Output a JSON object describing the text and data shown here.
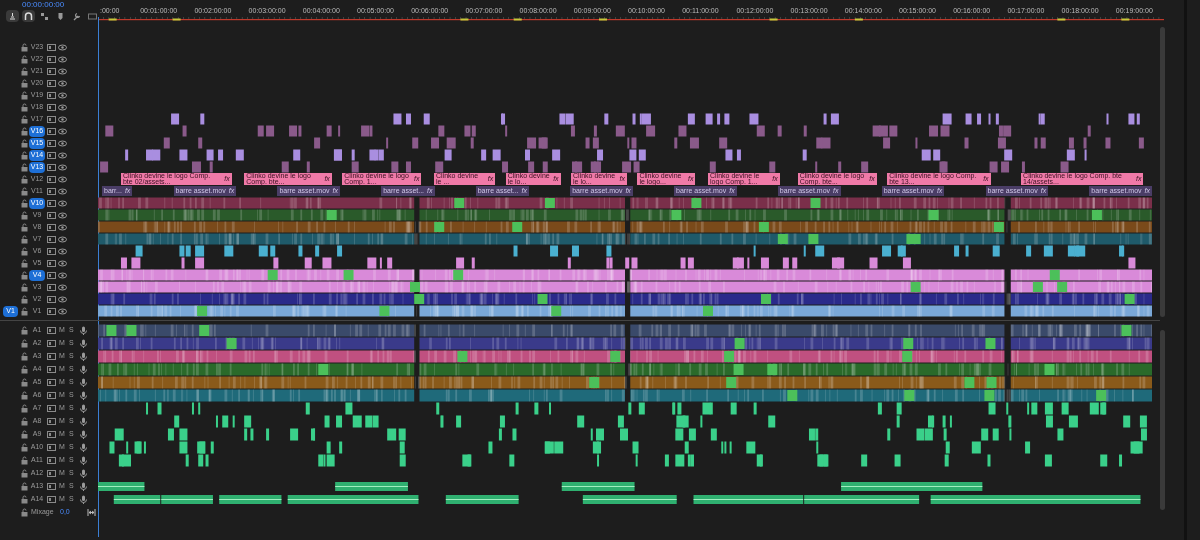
{
  "timecode": "00:00:00:00",
  "ruler": [
    ":00:00",
    "00:01:00:00",
    "00:02:00:00",
    "00:03:00:00",
    "00:04:00:00",
    "00:05:00:00",
    "00:06:00:00",
    "00:07:00:00",
    "00:08:00:00",
    "00:09:00:00",
    "00:10:00:00",
    "00:11:00:00",
    "00:12:00:00",
    "00:13:00:00",
    "00:14:00:00",
    "00:15:00:00",
    "00:16:00:00",
    "00:17:00:00",
    "00:18:00:00",
    "00:19:00:00"
  ],
  "video_tracks": [
    {
      "name": "V23",
      "targeted": false,
      "kind": "empty"
    },
    {
      "name": "V22",
      "targeted": false,
      "kind": "empty"
    },
    {
      "name": "V21",
      "targeted": false,
      "kind": "empty"
    },
    {
      "name": "V20",
      "targeted": false,
      "kind": "empty"
    },
    {
      "name": "V19",
      "targeted": false,
      "kind": "empty"
    },
    {
      "name": "V18",
      "targeted": false,
      "kind": "empty"
    },
    {
      "name": "V17",
      "targeted": false,
      "kind": "sparse",
      "color": "#a98ee0"
    },
    {
      "name": "V16",
      "targeted": true,
      "kind": "sparse",
      "color": "#8a5a8a"
    },
    {
      "name": "V15",
      "targeted": true,
      "kind": "sparse",
      "color": "#8a5a8a"
    },
    {
      "name": "V14",
      "targeted": true,
      "kind": "sparse",
      "color": "#a98ee0"
    },
    {
      "name": "V13",
      "targeted": true,
      "kind": "sparse",
      "color": "#8a5a8a"
    },
    {
      "name": "V12",
      "targeted": false,
      "kind": "titles",
      "color": "#f07aa8",
      "clips": [
        {
          "label": "Clinko devine le logo Comp. bte 02/assets...",
          "badge": "fx"
        },
        {
          "label": "Clinko devine le logo Comp. bte...",
          "badge": "fx"
        },
        {
          "label": "Clinko devine le logo Comp. 1...",
          "badge": "fx"
        },
        {
          "label": "Clinko devine le ...",
          "badge": "fx"
        },
        {
          "label": "Clinko devine le lo...",
          "badge": "fx"
        },
        {
          "label": "Clinko devine le lo...",
          "badge": "fx"
        },
        {
          "label": "Clinko devine le logo...",
          "badge": "fx"
        },
        {
          "label": "Clinko devine le logo Comp. 1...",
          "badge": "fx"
        },
        {
          "label": "Clinko devine le logo Comp. bte...",
          "badge": "fx"
        },
        {
          "label": "Clinko devine le logo Comp. bte 13...",
          "badge": "fx"
        },
        {
          "label": "Clinko devine le logo Comp. bte 14/assets...",
          "badge": "fx"
        }
      ]
    },
    {
      "name": "V11",
      "targeted": false,
      "kind": "assets",
      "color": "#4a3d66",
      "clips": [
        {
          "label": "barr...",
          "badge": "fx"
        },
        {
          "label": "barre asset.mov",
          "badge": "fx"
        },
        {
          "label": "barre asset.mov",
          "badge": "fx"
        },
        {
          "label": "barre asset...",
          "badge": "fx"
        },
        {
          "label": "barre asset...",
          "badge": "fx"
        },
        {
          "label": "barre asset.mov",
          "badge": "fx"
        },
        {
          "label": "barre asset.mov",
          "badge": "fx"
        },
        {
          "label": "barre asset.mov",
          "badge": "fx"
        },
        {
          "label": "barre asset.mov",
          "badge": "fx"
        },
        {
          "label": "barre asset.mov",
          "badge": "fx"
        },
        {
          "label": "barre asset.mov",
          "badge": "fx"
        }
      ]
    },
    {
      "name": "V10",
      "targeted": true,
      "kind": "dense",
      "color": "#7a2f4a"
    },
    {
      "name": "V9",
      "targeted": false,
      "kind": "dense",
      "color": "#2a5a2a"
    },
    {
      "name": "V8",
      "targeted": false,
      "kind": "dense",
      "color": "#7a4a1a"
    },
    {
      "name": "V7",
      "targeted": false,
      "kind": "dense",
      "color": "#1f5a6a"
    },
    {
      "name": "V6",
      "targeted": false,
      "kind": "sparse",
      "color": "#4ab0d0"
    },
    {
      "name": "V5",
      "targeted": false,
      "kind": "sparse",
      "color": "#d98ad9"
    },
    {
      "name": "V4",
      "targeted": true,
      "kind": "dense",
      "color": "#d98ad9"
    },
    {
      "name": "V3",
      "targeted": false,
      "kind": "dense",
      "color": "#d98ad9"
    },
    {
      "name": "V2",
      "targeted": false,
      "kind": "dense",
      "color": "#2a2a8a"
    },
    {
      "name": "V1",
      "targeted": false,
      "source": "V1",
      "kind": "dense",
      "color": "#7aa8d8"
    }
  ],
  "audio_tracks": [
    {
      "name": "A1",
      "kind": "dense",
      "color": "#3a4a6a",
      "buttons": [
        "M",
        "S"
      ]
    },
    {
      "name": "A2",
      "kind": "dense",
      "color": "#3a3a8a",
      "buttons": [
        "M",
        "S"
      ]
    },
    {
      "name": "A3",
      "kind": "dense",
      "color": "#c05080",
      "buttons": [
        "M",
        "S"
      ]
    },
    {
      "name": "A4",
      "kind": "dense",
      "color": "#2a6a2a",
      "buttons": [
        "M",
        "S"
      ]
    },
    {
      "name": "A5",
      "kind": "dense",
      "color": "#8a5a1a",
      "buttons": [
        "M",
        "S"
      ]
    },
    {
      "name": "A6",
      "kind": "dense",
      "color": "#1f6a7a",
      "buttons": [
        "M",
        "S"
      ]
    },
    {
      "name": "A7",
      "kind": "sparse",
      "color": "#3ad08a",
      "buttons": [
        "M",
        "S"
      ]
    },
    {
      "name": "A8",
      "kind": "sparse",
      "color": "#3ad08a",
      "buttons": [
        "M",
        "S"
      ]
    },
    {
      "name": "A9",
      "kind": "sparse",
      "color": "#3ad08a",
      "buttons": [
        "M",
        "S"
      ]
    },
    {
      "name": "A10",
      "kind": "sparse",
      "color": "#3ad08a",
      "buttons": [
        "M",
        "S"
      ]
    },
    {
      "name": "A11",
      "kind": "sparse",
      "color": "#3ad08a",
      "buttons": [
        "M",
        "S"
      ]
    },
    {
      "name": "A12",
      "kind": "empty",
      "buttons": [
        "M",
        "S"
      ]
    },
    {
      "name": "A13",
      "kind": "bars",
      "color": "#2fb070",
      "buttons": [
        "M",
        "S"
      ]
    },
    {
      "name": "A14",
      "kind": "bars",
      "color": "#2fb070",
      "buttons": [
        "M",
        "S"
      ]
    }
  ],
  "mix": {
    "label": "Mixage",
    "value": "0,0"
  }
}
